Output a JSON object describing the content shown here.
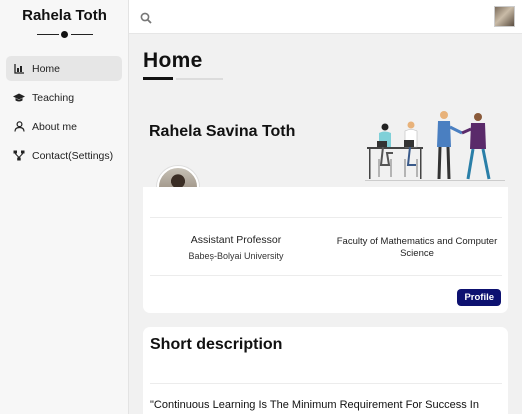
{
  "sidebar": {
    "brand": "Rahela Toth",
    "items": [
      {
        "label": "Home",
        "icon": "chart-bars-icon",
        "active": true
      },
      {
        "label": "Teaching",
        "icon": "graduation-cap-icon",
        "active": false
      },
      {
        "label": "About me",
        "icon": "user-icon",
        "active": false
      },
      {
        "label": "Contact(Settings)",
        "icon": "network-icon",
        "active": false
      }
    ]
  },
  "topbar": {
    "search_placeholder": "",
    "search_icon": "search-icon"
  },
  "main": {
    "title": "Home",
    "profile": {
      "name": "Rahela Savina Toth",
      "role": "Assistant Professor",
      "university": "Babeș-Bolyai University",
      "faculty": "Faculty of Mathematics and Computer Science",
      "button_label": "Profile"
    },
    "description": {
      "title": "Short description",
      "quote": "\"Continuous Learning Is The Minimum Requirement For Success In"
    }
  },
  "colors": {
    "accent": "#0d1170",
    "sidebar_bg": "#f7f7f7",
    "page_bg": "#f1f1f1"
  }
}
